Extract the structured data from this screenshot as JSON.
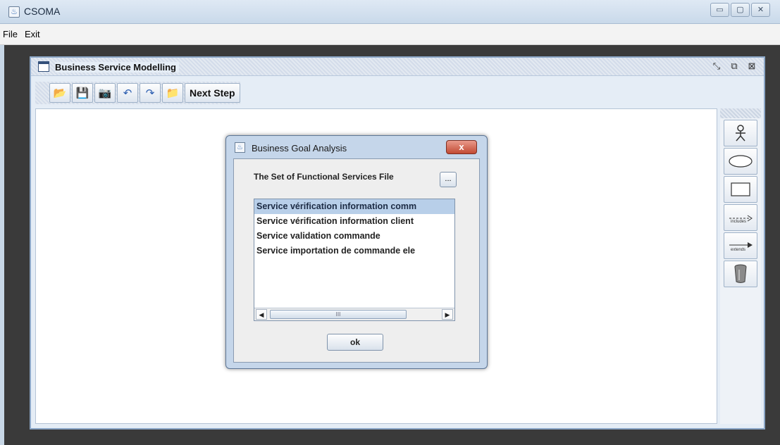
{
  "app": {
    "title": "CSOMA",
    "icon": "java-icon"
  },
  "window_controls": {
    "minimize": "minimize-icon",
    "maximize": "maximize-icon",
    "close": "close-icon"
  },
  "menubar": {
    "items": [
      {
        "label": "File"
      },
      {
        "label": "Exit"
      }
    ]
  },
  "internal_frame": {
    "title": "Business Service Modelling",
    "controls": [
      "minimize-icon",
      "restore-icon",
      "close-icon"
    ]
  },
  "toolbar": {
    "buttons": [
      {
        "icon": "new-icon",
        "glyph": "📂"
      },
      {
        "icon": "save-icon",
        "glyph": "💾"
      },
      {
        "icon": "camera-icon",
        "glyph": "📷"
      },
      {
        "icon": "undo-icon",
        "glyph": "↶"
      },
      {
        "icon": "redo-icon",
        "glyph": "↷"
      },
      {
        "icon": "open-folder-icon",
        "glyph": "📁"
      }
    ],
    "next_step_label": "Next Step"
  },
  "palette": {
    "tools": [
      {
        "name": "actor-tool",
        "icon": "actor-icon"
      },
      {
        "name": "ellipse-tool",
        "icon": "ellipse-icon"
      },
      {
        "name": "rectangle-tool",
        "icon": "rectangle-icon"
      },
      {
        "name": "include-tool",
        "icon": "include-arrow-icon",
        "label": "includes"
      },
      {
        "name": "extend-tool",
        "icon": "extend-arrow-icon",
        "label": "extends"
      },
      {
        "name": "delete-tool",
        "icon": "trash-icon"
      }
    ]
  },
  "dialog": {
    "title": "Business Goal Analysis",
    "close_label": "x",
    "fs_label": "The Set of Functional Services File",
    "browse_label": "...",
    "services": [
      "Service vérification information comm",
      "Service vérification information client",
      "Service validation commande",
      "Service importation de commande ele"
    ],
    "selected_index": 0,
    "scroll": {
      "left_arrow": "◀",
      "right_arrow": "▶",
      "thumb_grip": "III"
    },
    "ok_label": "ok"
  },
  "colors": {
    "accent": "#3a6fb4",
    "selection": "#b8cfe9",
    "close_button": "#c24a33"
  }
}
